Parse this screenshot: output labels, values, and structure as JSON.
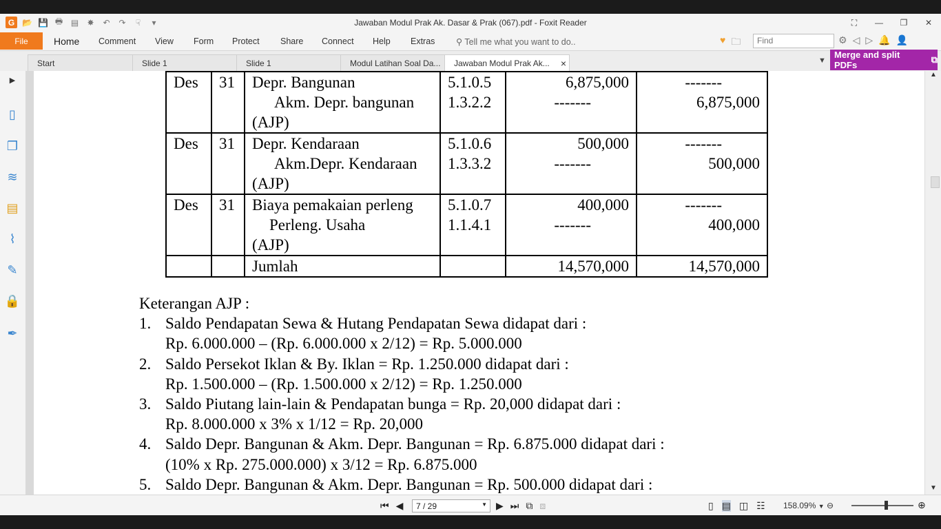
{
  "window": {
    "title": "Jawaban Modul Prak Ak. Dasar & Prak (067).pdf - Foxit Reader",
    "controls": [
      "⛶",
      "—",
      "❐",
      "✕"
    ]
  },
  "quick_access": [
    "G",
    "📂",
    "💾",
    "🖶",
    "▤",
    "✸",
    "↶",
    "↷",
    "☟",
    "▾"
  ],
  "menu": {
    "file": "File",
    "items": [
      "Home",
      "Comment",
      "View",
      "Form",
      "Protect",
      "Share",
      "Connect",
      "Help",
      "Extras"
    ],
    "tell_me": "Tell me what you want to do..",
    "find_placeholder": "Find"
  },
  "tabs": [
    {
      "label": "Start"
    },
    {
      "label": "Slide 1"
    },
    {
      "label": "Slide 1"
    },
    {
      "label": "Modul Latihan Soal Da..."
    },
    {
      "label": "Jawaban Modul Prak Ak...",
      "close": "×"
    }
  ],
  "merge_button": "Merge and split PDFs",
  "table": {
    "rows": [
      {
        "month": "Des",
        "day": "31",
        "account": [
          "Depr. Bangunan",
          "Akm. Depr. bangunan",
          "(AJP)"
        ],
        "ref": [
          "5.1.0.5",
          "1.3.2.2"
        ],
        "debit": [
          "6,875,000",
          "-------"
        ],
        "credit": [
          "-------",
          "6,875,000"
        ]
      },
      {
        "month": "Des",
        "day": "31",
        "account": [
          "Depr. Kendaraan",
          "Akm.Depr. Kendaraan",
          "(AJP)"
        ],
        "ref": [
          "5.1.0.6",
          "1.3.3.2"
        ],
        "debit": [
          "500,000",
          "-------"
        ],
        "credit": [
          "-------",
          "500,000"
        ]
      },
      {
        "month": "Des",
        "day": "31",
        "account": [
          "Biaya pemakaian perleng",
          "Perleng. Usaha",
          "(AJP)"
        ],
        "ref": [
          "5.1.0.7",
          "1.1.4.1"
        ],
        "debit": [
          "400,000",
          "-------"
        ],
        "credit": [
          "-------",
          "400,000"
        ]
      }
    ],
    "total": {
      "label": "Jumlah",
      "debit": "14,570,000",
      "credit": "14,570,000"
    }
  },
  "notes": {
    "heading": "Keterangan AJP :",
    "items": [
      {
        "num": "1.",
        "lines": [
          "Saldo Pendapatan Sewa & Hutang Pendapatan Sewa didapat dari :",
          "Rp. 6.000.000 – (Rp. 6.000.000 x 2/12) = Rp. 5.000.000"
        ]
      },
      {
        "num": "2.",
        "lines": [
          "Saldo Persekot Iklan & By. Iklan = Rp. 1.250.000 didapat dari :",
          "Rp. 1.500.000 – (Rp. 1.500.000 x 2/12) = Rp. 1.250.000"
        ]
      },
      {
        "num": "3.",
        "lines": [
          "Saldo Piutang lain-lain & Pendapatan bunga = Rp. 20,000 didapat dari :",
          "Rp. 8.000.000  x 3% x 1/12 = Rp. 20,000"
        ]
      },
      {
        "num": "4.",
        "lines": [
          "Saldo Depr. Bangunan & Akm. Depr. Bangunan = Rp. 6.875.000 didapat dari :",
          "(10% x Rp. 275.000.000) x 3/12 = Rp. 6.875.000"
        ]
      },
      {
        "num": "5.",
        "lines": [
          "Saldo Depr. Bangunan & Akm. Depr. Bangunan = Rp. 500.000 didapat dari :"
        ]
      }
    ]
  },
  "status": {
    "page": "7 / 29",
    "zoom": "158.09%"
  }
}
